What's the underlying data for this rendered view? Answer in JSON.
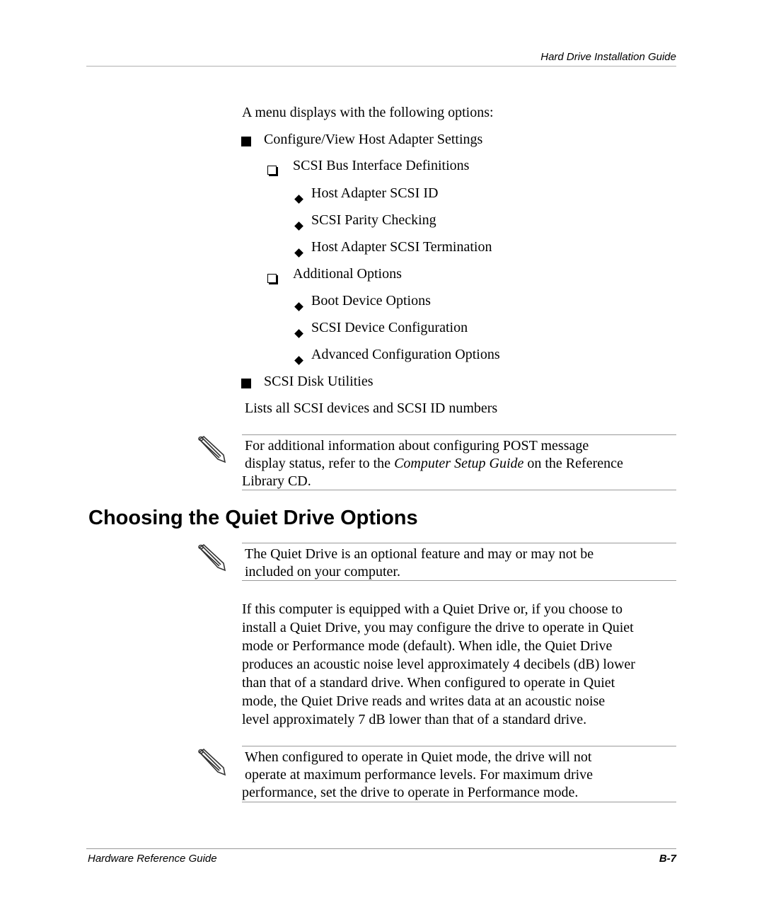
{
  "header": {
    "running_title": "Hard Drive Installation Guide"
  },
  "intro": "A menu displays with the following options:",
  "menu": {
    "item1": {
      "label": "Configure/View Host Adapter Settings",
      "sub1": {
        "label": "SCSI Bus Interface Definitions",
        "items": [
          "Host Adapter SCSI ID",
          "SCSI Parity Checking",
          "Host Adapter SCSI Termination"
        ]
      },
      "sub2": {
        "label": "Additional Options",
        "items": [
          "Boot Device Options",
          "SCSI Device Configuration",
          "Advanced Configuration Options"
        ]
      }
    },
    "item2": {
      "label": "SCSI Disk Utilities",
      "description": "Lists all SCSI devices and SCSI ID numbers"
    }
  },
  "note1": {
    "line1": "For additional information about configuring POST message",
    "line2_pre": "display status, refer to the ",
    "line2_italic": "Computer Setup Guide",
    "line2_post": " on the Reference",
    "line3": "Library CD."
  },
  "section": {
    "title": "Choosing the Quiet Drive Options",
    "note2": {
      "line1": "The Quiet Drive is an optional feature and may or may not be",
      "line2": "included on your computer."
    },
    "paragraph": [
      "If this computer is equipped with a Quiet Drive or, if you choose to",
      "install a Quiet Drive, you may configure the drive to operate in Quiet",
      "mode or Performance mode (default). When idle, the Quiet Drive",
      "produces an acoustic noise level approximately 4 decibels (dB) lower",
      "than that of a standard drive. When configured to operate in Quiet",
      "mode, the Quiet Drive reads and writes data at an acoustic noise",
      "level approximately 7 dB lower than that of a standard drive."
    ],
    "note3": {
      "line1": "When configured to operate in Quiet mode, the drive will not",
      "line2": "operate at maximum performance levels. For maximum drive",
      "line3": "performance, set the drive to operate in Performance mode."
    }
  },
  "footer": {
    "guide_title": "Hardware Reference Guide",
    "page_number": "B-7"
  }
}
